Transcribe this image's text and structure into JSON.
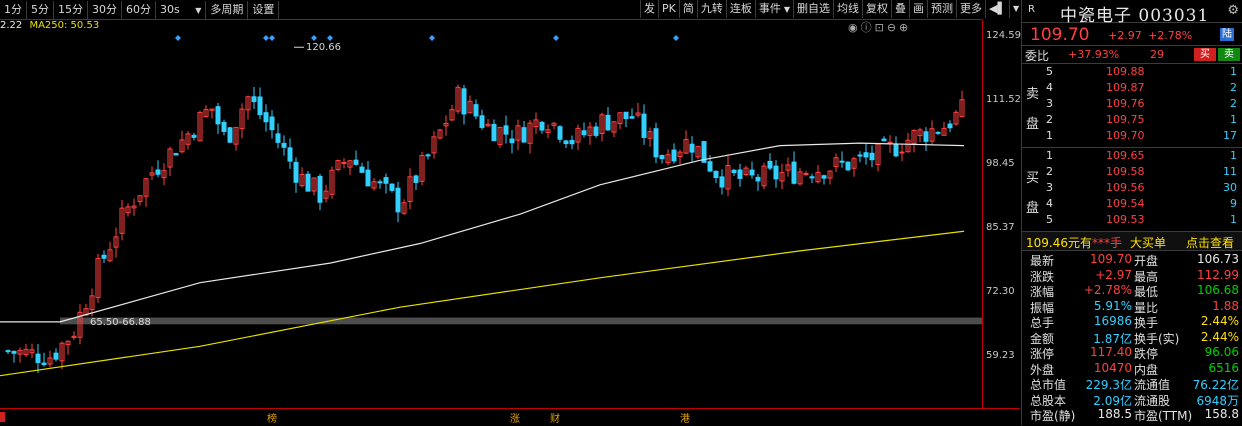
{
  "toolbar": {
    "left": [
      "1分",
      "5分",
      "15分",
      "30分",
      "60分",
      "30s",
      "多周期",
      "设置"
    ],
    "right": [
      "发",
      "PK",
      "简",
      "九转",
      "连板",
      "事件",
      "删自选",
      "均线",
      "复权",
      "叠",
      "画",
      "预测",
      "更多"
    ]
  },
  "ma_legend": {
    "prefix": "2.22",
    "ma250_label": "MA250: 50.53"
  },
  "chart_annotations": {
    "high_label": "120.66",
    "range_label": "65.50-66.88"
  },
  "price_axis": [
    "124.59",
    "111.52",
    "98.45",
    "85.37",
    "72.30",
    "59.23"
  ],
  "event_marks": [
    "榜",
    "涨",
    "财",
    "港"
  ],
  "colors": {
    "up": "#ff4040",
    "down": "#33d0ff",
    "ma_white": "#e8e8e8",
    "ma_yellow": "#e8e000",
    "axis": "#c00000"
  },
  "stock": {
    "market": "R",
    "title": "中瓷电子 003031",
    "price": "109.70",
    "change": "+2.97",
    "pct": "+2.78%",
    "lu_badge": "陆",
    "webi_label": "委比",
    "webi": "+37.93%",
    "webi_diff": "29",
    "buy_btn": "买",
    "sell_btn": "卖",
    "sell_side": "卖盘",
    "buy_side": "买盘",
    "sells": [
      {
        "lv": "5",
        "price": "109.88",
        "vol": "1"
      },
      {
        "lv": "4",
        "price": "109.87",
        "vol": "2"
      },
      {
        "lv": "3",
        "price": "109.76",
        "vol": "2"
      },
      {
        "lv": "2",
        "price": "109.75",
        "vol": "1"
      },
      {
        "lv": "1",
        "price": "109.70",
        "vol": "17"
      }
    ],
    "buys": [
      {
        "lv": "1",
        "price": "109.65",
        "vol": "1"
      },
      {
        "lv": "2",
        "price": "109.58",
        "vol": "11"
      },
      {
        "lv": "3",
        "price": "109.56",
        "vol": "30"
      },
      {
        "lv": "4",
        "price": "109.54",
        "vol": "9"
      },
      {
        "lv": "5",
        "price": "109.53",
        "vol": "1"
      }
    ],
    "bigbuy": {
      "price": "109.46元有",
      "qty": "***手",
      "label": "大买单",
      "link": "点击查看"
    },
    "quotes": [
      {
        "l1": "最新",
        "v1": "109.70",
        "c1": "red",
        "l2": "开盘",
        "v2": "106.73",
        "c2": "white"
      },
      {
        "l1": "涨跌",
        "v1": "+2.97",
        "c1": "red",
        "l2": "最高",
        "v2": "112.99",
        "c2": "red"
      },
      {
        "l1": "涨幅",
        "v1": "+2.78%",
        "c1": "red",
        "l2": "最低",
        "v2": "106.68",
        "c2": "green"
      },
      {
        "l1": "振幅",
        "v1": "5.91%",
        "c1": "cyan",
        "l2": "量比",
        "v2": "1.88",
        "c2": "red"
      },
      {
        "l1": "总手",
        "v1": "16986",
        "c1": "cyan",
        "l2": "换手",
        "v2": "2.44%",
        "c2": "yellow"
      },
      {
        "l1": "金额",
        "v1": "1.87亿",
        "c1": "cyan",
        "l2": "换手(实)",
        "v2": "2.44%",
        "c2": "yellow"
      },
      {
        "l1": "涨停",
        "v1": "117.40",
        "c1": "red",
        "l2": "跌停",
        "v2": "96.06",
        "c2": "green"
      },
      {
        "l1": "外盘",
        "v1": "10470",
        "c1": "red",
        "l2": "内盘",
        "v2": "6516",
        "c2": "green"
      },
      {
        "l1": "总市值",
        "v1": "229.3亿",
        "c1": "cyan",
        "l2": "流通值",
        "v2": "76.22亿",
        "c2": "cyan"
      },
      {
        "l1": "总股本",
        "v1": "2.09亿",
        "c1": "cyan",
        "l2": "流通股",
        "v2": "6948万",
        "c2": "cyan"
      },
      {
        "l1": "市盈(静)",
        "v1": "188.5",
        "c1": "white",
        "l2": "市盈(TTM)",
        "v2": "158.8",
        "c2": "white"
      }
    ]
  }
}
